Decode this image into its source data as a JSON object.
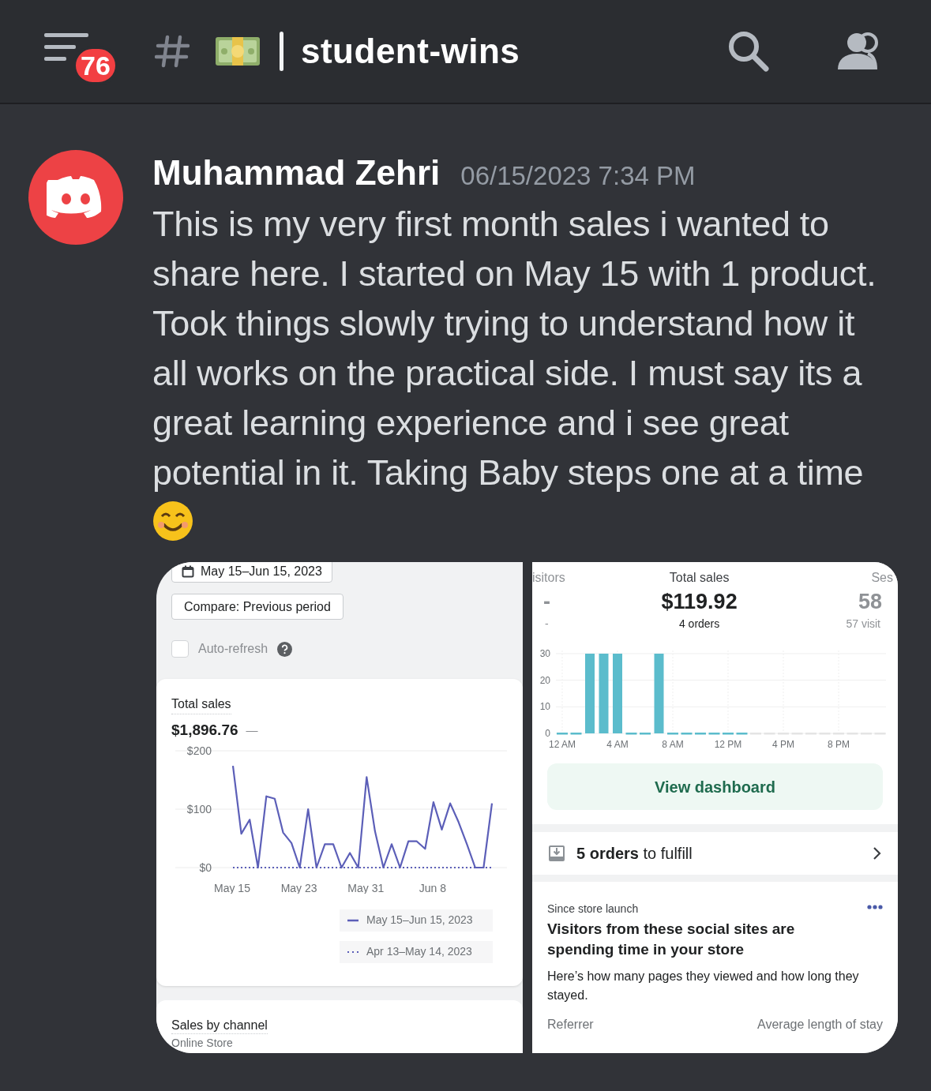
{
  "header": {
    "unread_badge": "76",
    "channel_name": "student-wins"
  },
  "message": {
    "author": "Muhammad Zehri",
    "timestamp": "06/15/2023 7:34 PM",
    "text": "This is my very first month sales i wanted to share here. I started on May 15 with 1 product. Took things slowly trying to understand how it all works on the practical side. I must say its a great learning experience and i see great potential in it. Taking Baby steps one at a time"
  },
  "analytics_screenshot": {
    "date_range": "May 15–Jun 15, 2023",
    "compare_button": "Compare: Previous period",
    "auto_refresh": {
      "label": "Auto-refresh",
      "checked": false
    },
    "total_sales": {
      "title": "Total sales",
      "value": "$1,896.76",
      "change": "—",
      "chart_data": {
        "type": "line",
        "grid": true,
        "categories": [
          "May 15",
          null,
          null,
          null,
          null,
          null,
          null,
          null,
          "May 23",
          null,
          null,
          null,
          null,
          null,
          null,
          null,
          "May 31",
          null,
          null,
          null,
          null,
          null,
          null,
          null,
          "Jun 8",
          null,
          null,
          null,
          null,
          null,
          null,
          null
        ],
        "ylim": [
          0,
          200
        ],
        "yticks": [
          {
            "value": 0,
            "label": "$0"
          },
          {
            "value": 100,
            "label": "$100"
          },
          {
            "value": 200,
            "label": "$200"
          }
        ],
        "series": [
          {
            "name": "May 15–Jun 15, 2023",
            "color": "#5c5fb8",
            "line_style": "solid",
            "values": [
              174,
              58,
              82,
              0,
              122,
              118,
              60,
              42,
              0,
              100,
              0,
              40,
              40,
              0,
              25,
              0,
              155,
              62,
              0,
              40,
              0,
              45,
              45,
              32,
              112,
              65,
              110,
              78,
              40,
              0,
              0,
              110
            ]
          },
          {
            "name": "Apr 13–May 14, 2023",
            "color": "#5c5fb8",
            "line_style": "dotted",
            "values": [
              0,
              0,
              0,
              0,
              0,
              0,
              0,
              0,
              0,
              0,
              0,
              0,
              0,
              0,
              0,
              0,
              0,
              0,
              0,
              0,
              0,
              0,
              0,
              0,
              0,
              0,
              0,
              0,
              0,
              0,
              0,
              0
            ]
          }
        ]
      }
    },
    "sales_by_channel": {
      "title": "Sales by channel",
      "row": "Online Store"
    }
  },
  "home_screenshot": {
    "stats": [
      {
        "kind": "faded",
        "label": "isitors",
        "value": "-",
        "sub": "-"
      },
      {
        "kind": "primary",
        "label": "Total sales",
        "value": "$119.92",
        "sub": "4 orders"
      },
      {
        "kind": "faded",
        "label": "Ses",
        "value": "58",
        "sub": "57 visit"
      }
    ],
    "chart_data": {
      "type": "bar",
      "grid": true,
      "categories": [
        "12 AM",
        null,
        null,
        null,
        "4 AM",
        null,
        null,
        null,
        "8 AM",
        null,
        null,
        null,
        "12 PM",
        null,
        null,
        null,
        "4 PM",
        null,
        null,
        null,
        "8 PM",
        null,
        null,
        null
      ],
      "ylim": [
        0,
        30
      ],
      "yticks": [
        0,
        10,
        20,
        30
      ],
      "series": [
        {
          "color": "#5bbccc",
          "values": [
            0,
            0,
            30,
            30,
            30,
            0,
            0,
            30,
            0,
            0,
            0,
            0,
            0,
            0,
            null,
            null,
            null,
            null,
            null,
            null,
            null,
            null,
            null,
            null
          ]
        }
      ]
    },
    "view_dashboard": "View dashboard",
    "orders_row": "**5 orders** to fulfill",
    "insight": {
      "eyebrow": "Since store launch",
      "title": "Visitors from these social sites are spending time in your store",
      "body": "Here’s how many pages they viewed and how long they stayed.",
      "columns": [
        "Referrer",
        "Average length of stay"
      ]
    }
  }
}
